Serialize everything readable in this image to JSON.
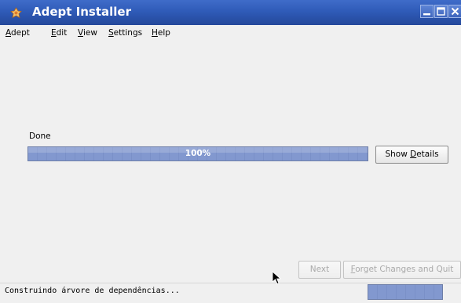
{
  "window": {
    "title": "Adept Installer",
    "buttons": [
      "minimize",
      "maximize",
      "close"
    ]
  },
  "menubar": {
    "items": [
      {
        "mnemonic": "A",
        "rest": "dept"
      },
      {
        "mnemonic": "E",
        "rest": "dit"
      },
      {
        "mnemonic": "V",
        "rest": "iew"
      },
      {
        "mnemonic": "S",
        "rest": "ettings"
      },
      {
        "mnemonic": "H",
        "rest": "elp"
      }
    ]
  },
  "main": {
    "status_label": "Done",
    "progress": {
      "value": 100,
      "text": "100%"
    },
    "show_details": {
      "before": "Show ",
      "mnemonic": "D",
      "rest": "etails"
    }
  },
  "footer": {
    "next_label": "Next",
    "forget": {
      "mnemonic": "F",
      "rest": "orget Changes and Quit"
    }
  },
  "statusbar": {
    "text": "Construindo árvore de dependências...",
    "progress_value": 100
  },
  "colors": {
    "titlebar": "#2f5bb8",
    "progress_fill": "#8298cf"
  },
  "icons": [
    "app-icon",
    "minimize-icon",
    "maximize-icon",
    "close-icon",
    "mouse-cursor-icon"
  ]
}
